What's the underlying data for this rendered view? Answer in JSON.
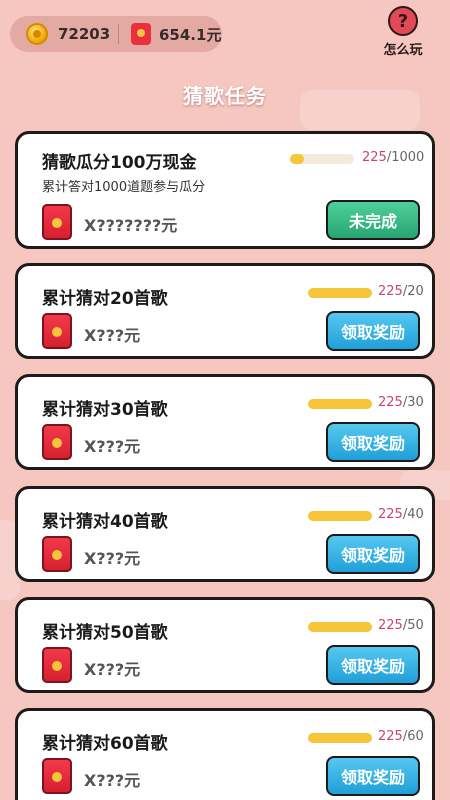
{
  "header": {
    "coins": "72203",
    "cash": "654.1元",
    "help_label": "怎么玩",
    "help_symbol": "?"
  },
  "page_title": "猜歌任务",
  "tasks": [
    {
      "title": "猜歌瓜分100万现金",
      "subtitle": "累计答对1000道题参与瓜分",
      "current": "225",
      "total": "/1000",
      "progress": 0.225,
      "reward": "X???????元",
      "button": "未完成"
    },
    {
      "title": "累计猜对20首歌",
      "current": "225",
      "total": "/20",
      "progress": 1,
      "reward": "X???元",
      "button": "领取奖励"
    },
    {
      "title": "累计猜对30首歌",
      "current": "225",
      "total": "/30",
      "progress": 1,
      "reward": "X???元",
      "button": "领取奖励"
    },
    {
      "title": "累计猜对40首歌",
      "current": "225",
      "total": "/40",
      "progress": 1,
      "reward": "X???元",
      "button": "领取奖励"
    },
    {
      "title": "累计猜对50首歌",
      "current": "225",
      "total": "/50",
      "progress": 1,
      "reward": "X???元",
      "button": "领取奖励"
    },
    {
      "title": "累计猜对60首歌",
      "current": "225",
      "total": "/60",
      "progress": 1,
      "reward": "X???元",
      "button": "领取奖励"
    }
  ],
  "colors": {
    "background": "#f6c7c0",
    "progress_fill": "#f6c53a",
    "button_incomplete": "#28a672",
    "button_claim": "#1f9fd8",
    "progress_current": "#c9456b"
  }
}
